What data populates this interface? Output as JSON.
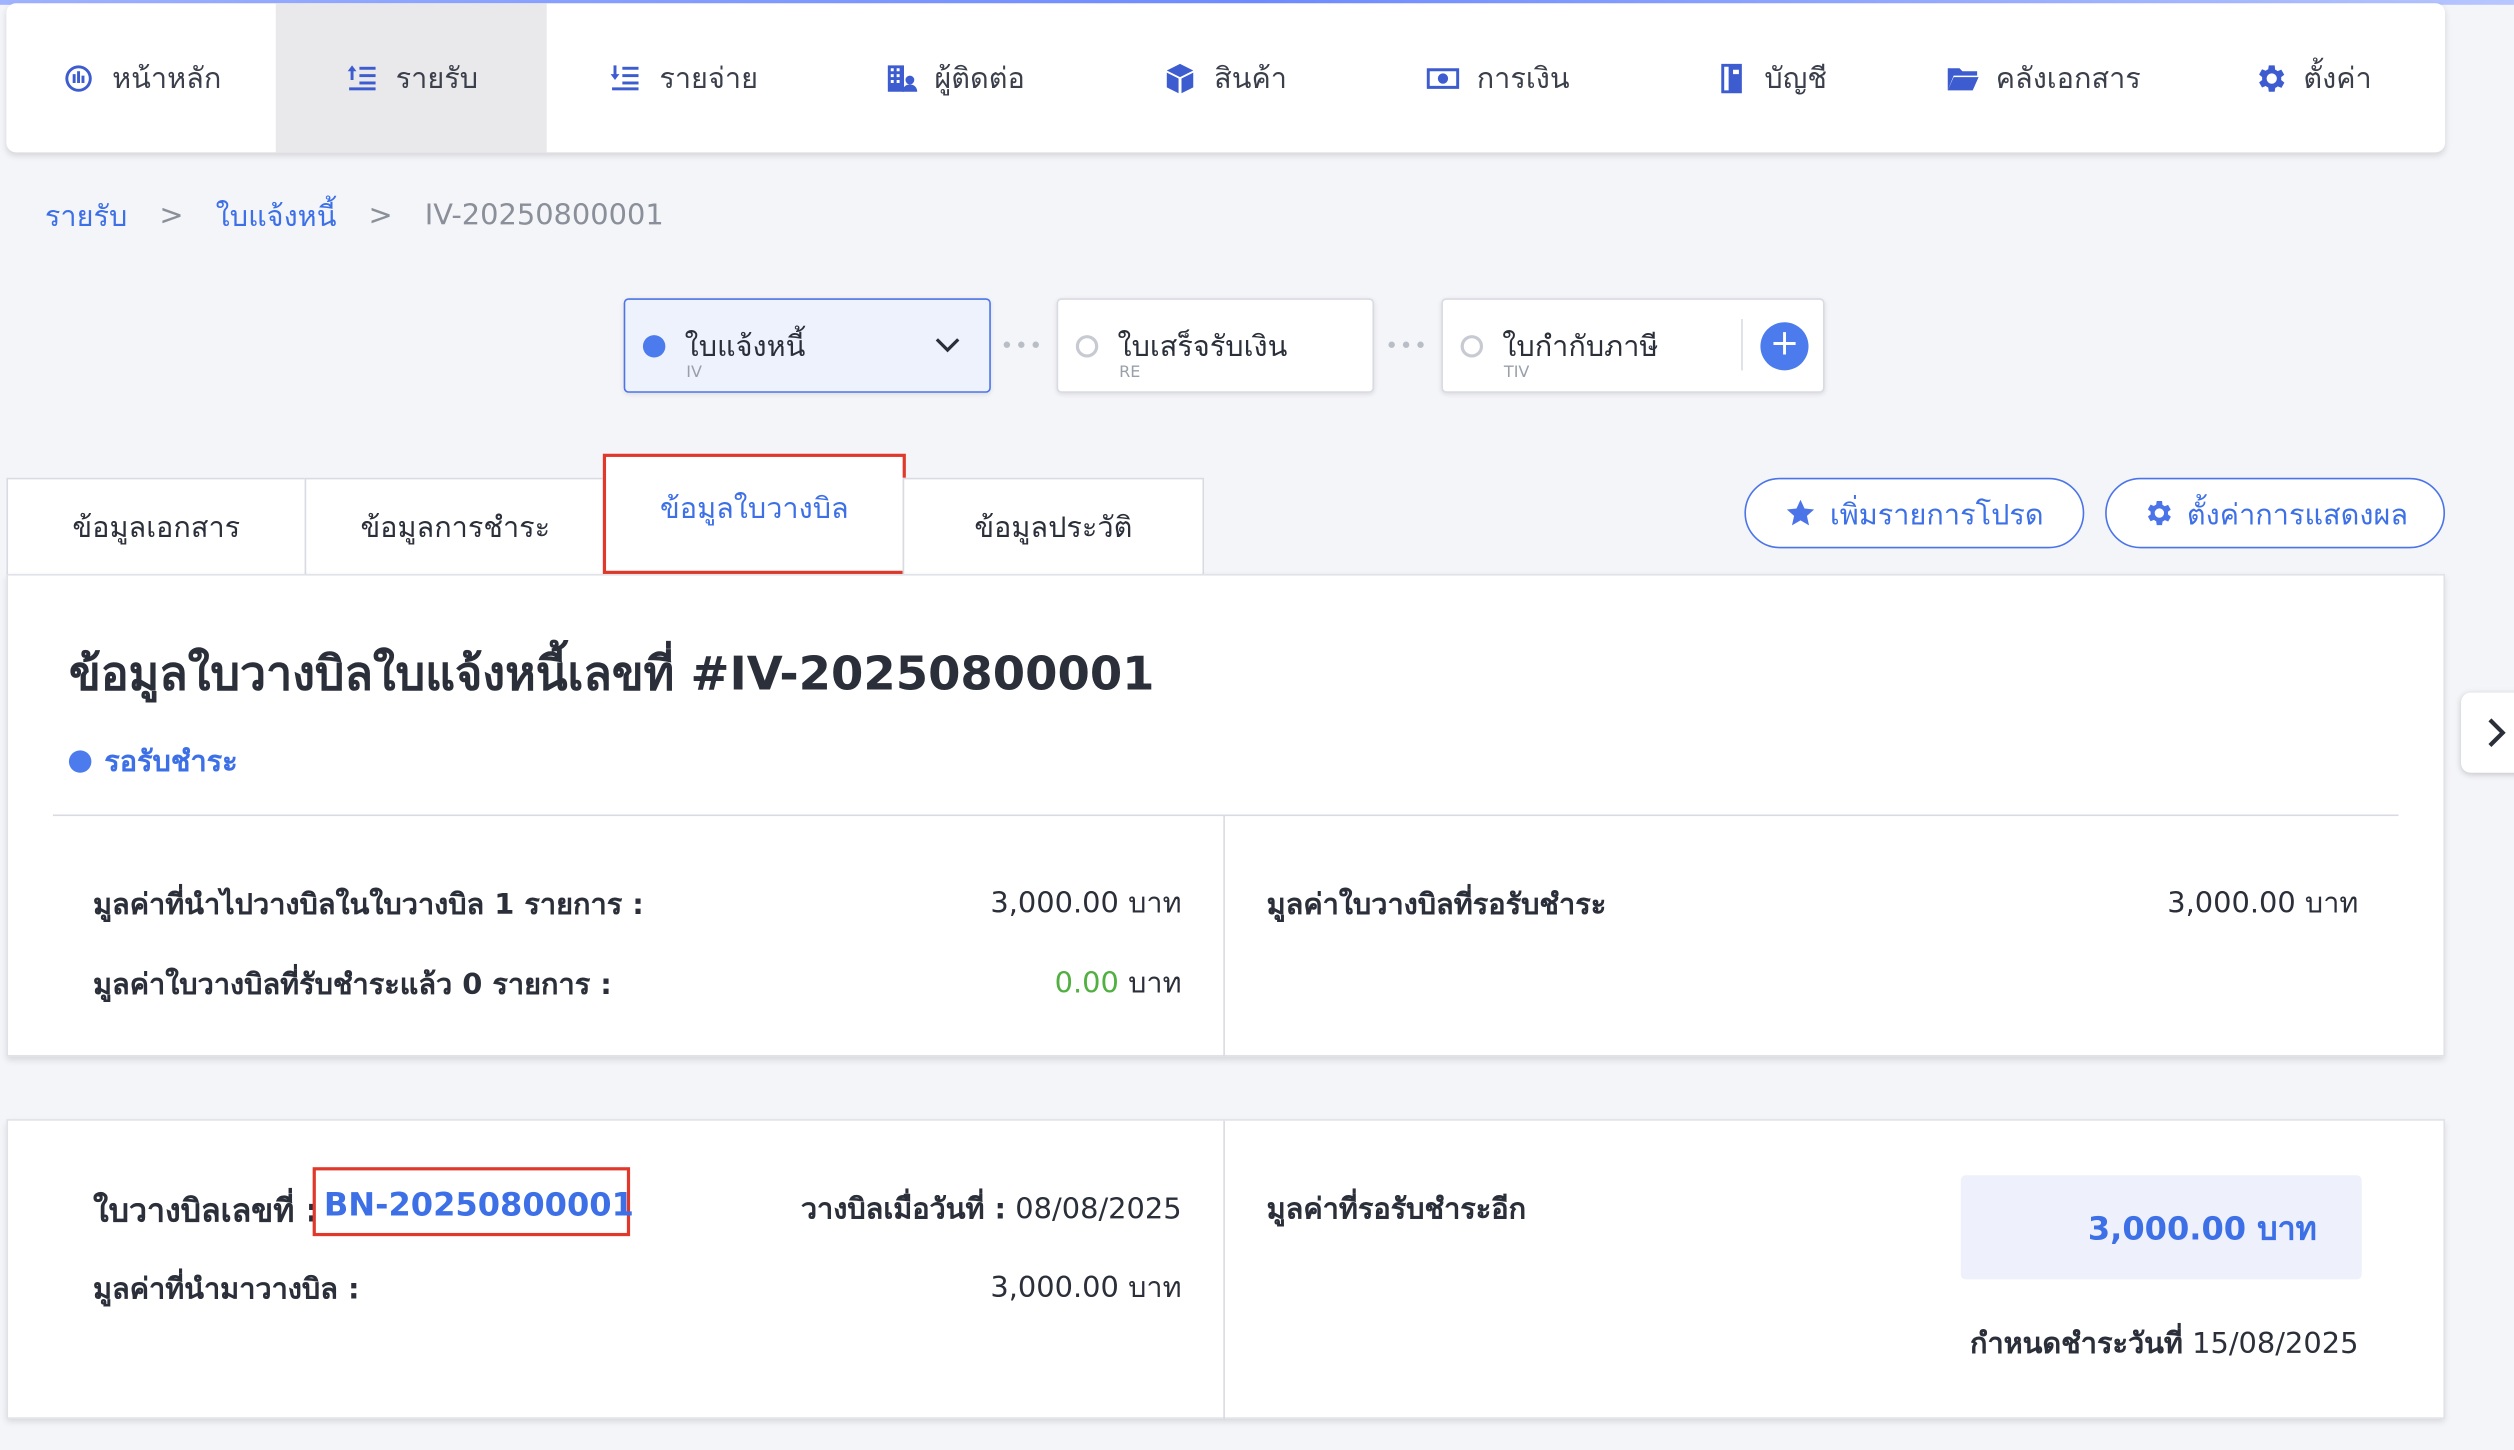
{
  "nav": {
    "items": [
      {
        "label": "หน้าหลัก",
        "icon": "dashboard-icon"
      },
      {
        "label": "รายรับ",
        "icon": "income-icon"
      },
      {
        "label": "รายจ่าย",
        "icon": "expense-icon"
      },
      {
        "label": "ผู้ติดต่อ",
        "icon": "contacts-icon"
      },
      {
        "label": "สินค้า",
        "icon": "product-box-icon"
      },
      {
        "label": "การเงิน",
        "icon": "money-icon"
      },
      {
        "label": "บัญชี",
        "icon": "ledger-book-icon"
      },
      {
        "label": "คลังเอกสาร",
        "icon": "folder-icon"
      },
      {
        "label": "ตั้งค่า",
        "icon": "gear-icon"
      }
    ],
    "active_index": 1
  },
  "breadcrumb": {
    "level1": "รายรับ",
    "level2": "ใบแจ้งหนี้",
    "current": "IV-20250800001",
    "separator": ">"
  },
  "flow": {
    "steps": [
      {
        "title": "ใบแจ้งหนี้",
        "code": "IV"
      },
      {
        "title": "ใบเสร็จรับเงิน",
        "code": "RE"
      },
      {
        "title": "ใบกำกับภาษี",
        "code": "TIV"
      }
    ],
    "add_label": "+"
  },
  "tabs": [
    "ข้อมูลเอกสาร",
    "ข้อมูลการชำระ",
    "ข้อมูลใบวางบิล",
    "ข้อมูลประวัติ"
  ],
  "actions": {
    "favorite_label": "เพิ่มรายการโปรด",
    "display_settings_label": "ตั้งค่าการแสดงผล"
  },
  "summary": {
    "title": "ข้อมูลใบวางบิลใบแจ้งหนี้เลขที่ #IV-20250800001",
    "status": "รอรับชำระ",
    "billed_label": "มูลค่าที่นำไปวางบิลในใบวางบิล 1 รายการ :",
    "billed_value": "3,000.00 บาท",
    "paid_label": "มูลค่าใบวางบิลที่รับชำระแล้ว 0 รายการ :",
    "paid_amount": "0.00",
    "paid_unit": "บาท",
    "pending_label": "มูลค่าใบวางบิลที่รอรับชำระ",
    "pending_value": "3,000.00 บาท"
  },
  "billing_note": {
    "number_label": "ใบวางบิลเลขที่ :",
    "number": "BN-20250800001",
    "date_label": "วางบิลเมื่อวันที่ :",
    "date": "08/08/2025",
    "amount_label": "มูลค่าที่นำมาวางบิล :",
    "amount": "3,000.00 บาท",
    "remaining_label": "มูลค่าที่รอรับชำระอีก",
    "remaining": "3,000.00 บาท",
    "due_label": "กำหนดชำระวันที่",
    "due_date": "15/08/2025"
  },
  "colors": {
    "accent": "#3d70e6",
    "highlight_border": "#e0392b",
    "paid_green": "#52b043",
    "amount_bg": "#eef0fb"
  }
}
